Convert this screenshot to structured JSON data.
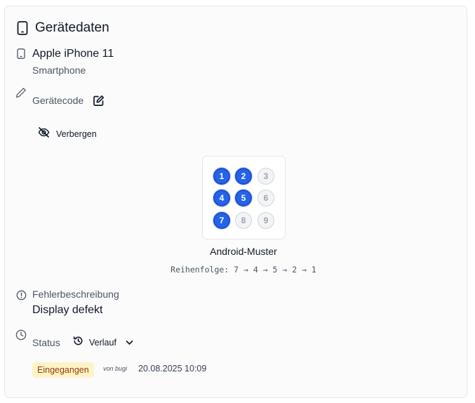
{
  "card": {
    "title": "Gerätedaten",
    "title_icon": "phone-icon"
  },
  "device": {
    "name": "Apple iPhone 11",
    "type": "Smartphone",
    "icon": "phone-icon"
  },
  "code": {
    "label": "Gerätecode",
    "edit_icon": "edit-icon",
    "field_icon": "pencil-icon",
    "hide_label": "Verbergen",
    "hide_icon": "eye-off-icon"
  },
  "pattern": {
    "dots": [
      {
        "num": "1",
        "active": true
      },
      {
        "num": "2",
        "active": true
      },
      {
        "num": "3",
        "active": false
      },
      {
        "num": "4",
        "active": true
      },
      {
        "num": "5",
        "active": true
      },
      {
        "num": "6",
        "active": false
      },
      {
        "num": "7",
        "active": true
      },
      {
        "num": "8",
        "active": false
      },
      {
        "num": "9",
        "active": false
      }
    ],
    "title": "Android-Muster",
    "sequence": "Reihenfolge: 7 → 4 → 5 → 2 → 1"
  },
  "error": {
    "label": "Fehlerbeschreibung",
    "value": "Display defekt",
    "icon": "alert-circle-icon"
  },
  "status": {
    "label": "Status",
    "icon": "clock-icon",
    "history_label": "Verlauf",
    "history_icon": "history-icon",
    "badge": "Eingegangen",
    "by": "von bugi",
    "timestamp": "20.08.2025 10:09"
  },
  "colors": {
    "accent": "#2563eb",
    "badge_bg": "#fef3c7",
    "badge_text": "#92400e"
  }
}
